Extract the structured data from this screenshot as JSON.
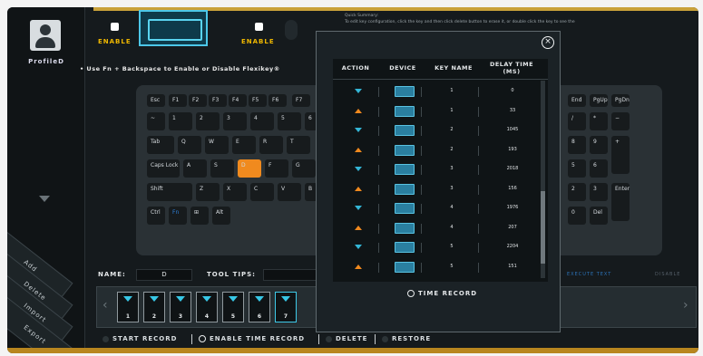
{
  "sidebar": {
    "profile_label": "ProfileD",
    "buttons": [
      "Add",
      "Delete",
      "Import",
      "Export"
    ]
  },
  "top": {
    "left_toggle_label": "ENABLE",
    "right_toggle_label": "ENABLE",
    "hint": "• Use Fn + Backspace to Enable or Disable Flexikey®",
    "quick_summary_title": "Quick Summary:",
    "quick_summary_text": "To edit key configuration, click the key and then click delete button to erase it, or double click the key to see the"
  },
  "keyboard": {
    "highlighted_key": "D"
  },
  "name_row": {
    "name_label": "NAME:",
    "name_value": "D",
    "tips_label": "TOOL TIPS:",
    "execute_text": "EXECUTE TEXT",
    "disable_text": "DISABLE"
  },
  "macro_keys": [
    "1",
    "2",
    "3",
    "4",
    "5",
    "6",
    "7"
  ],
  "bottom_bar": {
    "start_record": "START RECORD",
    "enable_time_record": "ENABLE TIME RECORD",
    "delete": "DELETE",
    "restore": "RESTORE"
  },
  "popup": {
    "headers": [
      "ACTION",
      "DEVICE",
      "KEY NAME",
      "DELAY TIME (MS)"
    ],
    "rows": [
      {
        "action": "down",
        "key": "1",
        "delay": "0"
      },
      {
        "action": "up",
        "key": "1",
        "delay": "33"
      },
      {
        "action": "down",
        "key": "2",
        "delay": "1045"
      },
      {
        "action": "up",
        "key": "2",
        "delay": "193"
      },
      {
        "action": "down",
        "key": "3",
        "delay": "2018"
      },
      {
        "action": "up",
        "key": "3",
        "delay": "156"
      },
      {
        "action": "down",
        "key": "4",
        "delay": "1976"
      },
      {
        "action": "up",
        "key": "4",
        "delay": "207"
      },
      {
        "action": "down",
        "key": "5",
        "delay": "2204"
      },
      {
        "action": "up",
        "key": "5",
        "delay": "151"
      }
    ],
    "time_record_label": "TIME RECORD"
  },
  "colors": {
    "accent_orange": "#f08a1e",
    "accent_cyan": "#34b6d6",
    "enable_yellow": "#f0b800"
  }
}
